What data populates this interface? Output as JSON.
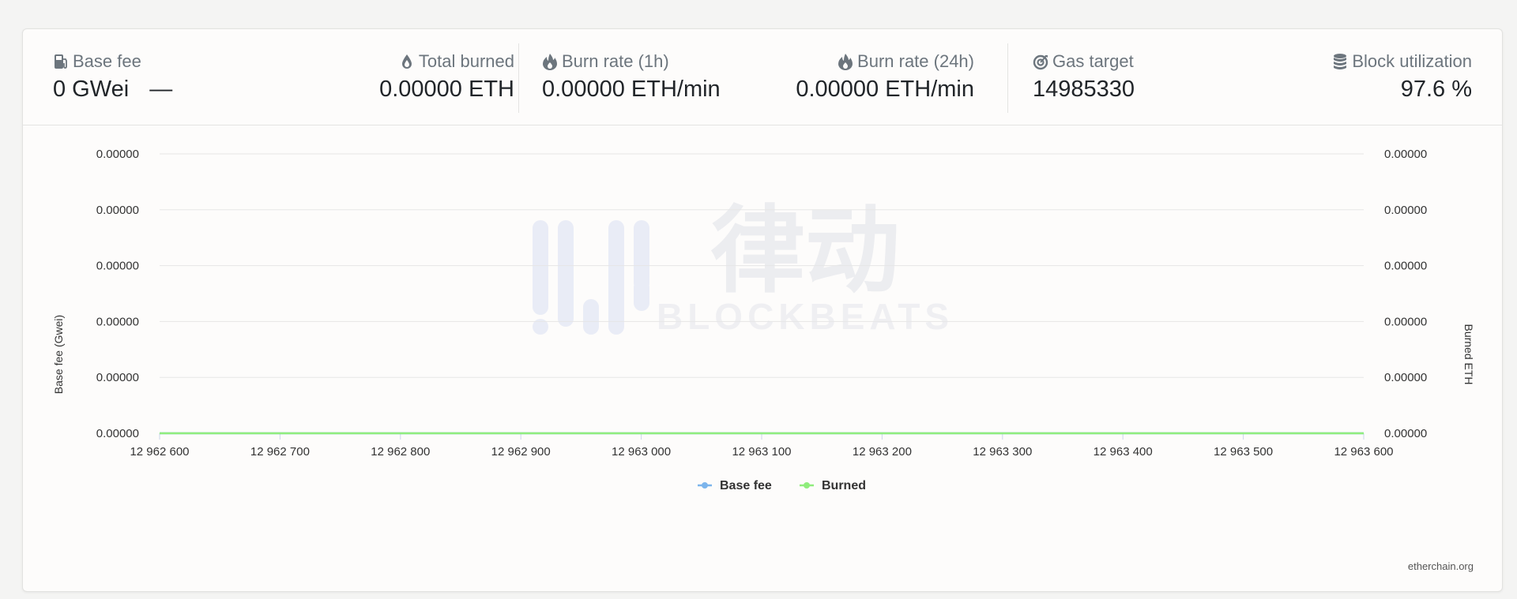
{
  "stats": {
    "base_fee": {
      "label": "Base fee",
      "value": "0 GWei",
      "trend": "—"
    },
    "total_burned": {
      "label": "Total burned",
      "value": "0.00000 ETH"
    },
    "burn_rate_1h": {
      "label": "Burn rate (1h)",
      "value": "0.00000 ETH/min"
    },
    "burn_rate_24h": {
      "label": "Burn rate (24h)",
      "value": "0.00000 ETH/min"
    },
    "gas_target": {
      "label": "Gas target",
      "value": "14985330"
    },
    "block_utilization": {
      "label": "Block utilization",
      "value": "97.6 %"
    }
  },
  "icons": {
    "base_fee": "gas-pump-icon",
    "total_burned": "drop-icon",
    "burn_rate_1h": "fire-icon",
    "burn_rate_24h": "fire-icon",
    "gas_target": "target-icon",
    "block_utilization": "database-icon"
  },
  "chart_data": {
    "type": "line",
    "xlabel": "",
    "ylabel": "Base fee (Gwei)",
    "y2label": "Burned ETH",
    "x_ticks": [
      "12 962 600",
      "12 962 700",
      "12 962 800",
      "12 962 900",
      "12 963 000",
      "12 963 100",
      "12 963 200",
      "12 963 300",
      "12 963 400",
      "12 963 500",
      "12 963 600"
    ],
    "xlim": [
      12962600,
      12963600
    ],
    "y_ticks": [
      "0.00000",
      "0.00000",
      "0.00000",
      "0.00000",
      "0.00000",
      "0.00000"
    ],
    "y2_ticks": [
      "0.00000",
      "0.00000",
      "0.00000",
      "0.00000",
      "0.00000",
      "0.00000"
    ],
    "ylim": [
      0,
      0
    ],
    "grid": true,
    "legend_position": "bottom",
    "series": [
      {
        "name": "Base fee",
        "color": "#7cb5ec",
        "x": [
          12962600,
          12963600
        ],
        "values": [
          0,
          0
        ]
      },
      {
        "name": "Burned",
        "color": "#90ed7d",
        "x": [
          12962600,
          12963600
        ],
        "values": [
          0,
          0
        ]
      }
    ]
  },
  "watermark": {
    "text": "律动",
    "subtext": "BLOCKBEATS"
  },
  "credit": "etherchain.org"
}
